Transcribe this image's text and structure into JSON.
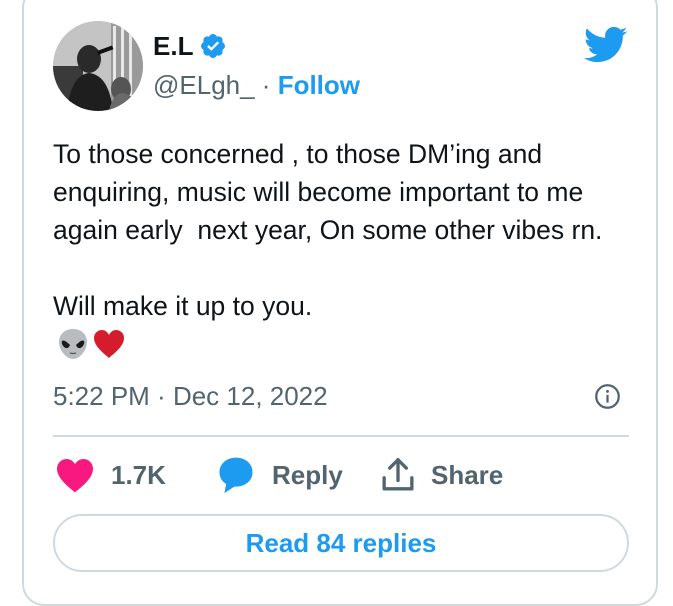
{
  "author": {
    "display_name": "E.L",
    "handle": "@ELgh_",
    "separator": " · ",
    "follow_label": "Follow",
    "verified": true
  },
  "tweet": {
    "lines": [
      "To those concerned , to those DM’ing and",
      "enquiring, music will become important to me",
      "again early  next year, On some other vibes rn.",
      "",
      "Will make it up to you."
    ],
    "emojis": [
      "alien-emoji",
      "red-heart-emoji"
    ],
    "time": "5:22 PM",
    "date_separator": " · ",
    "date": "Dec 12, 2022"
  },
  "actions": {
    "like_count": "1.7K",
    "reply_label": "Reply",
    "share_label": "Share"
  },
  "read_replies_label": "Read 84 replies",
  "colors": {
    "brand_blue": "#1d9bf0",
    "like_pink": "#f91880",
    "heart_red": "#d41c2c",
    "text_primary": "#0f1419",
    "text_secondary": "#536471",
    "border": "#cfd9de"
  },
  "icons": {
    "verified": "verified-badge-icon",
    "logo": "twitter-bird-icon",
    "info": "info-icon",
    "like": "heart-icon",
    "reply": "speech-bubble-icon",
    "share": "share-upload-icon"
  }
}
